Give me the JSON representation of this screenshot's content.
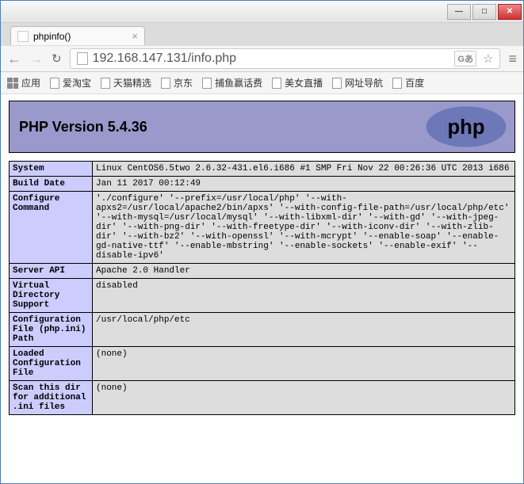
{
  "window": {
    "min": "—",
    "max": "□",
    "close": "✕"
  },
  "tab": {
    "title": "phpinfo()",
    "close": "×"
  },
  "toolbar": {
    "back": "←",
    "forward": "→",
    "reload": "↻",
    "url": "192.168.147.131/info.php",
    "translate": "Gあ",
    "star": "☆",
    "menu": "≡"
  },
  "bookmarks": {
    "apps": "应用",
    "items": [
      "爱淘宝",
      "天猫精选",
      "京东",
      "捕鱼赢话费",
      "美女直播",
      "网址导航",
      "百度"
    ]
  },
  "php": {
    "heading": "PHP Version 5.4.36",
    "logo_text": "php",
    "rows": [
      {
        "label": "System",
        "value": "Linux CentOS6.5two 2.6.32-431.el6.i686 #1 SMP Fri Nov 22 00:26:36 UTC 2013 i686"
      },
      {
        "label": "Build Date",
        "value": "Jan 11 2017 00:12:49"
      },
      {
        "label": "Configure Command",
        "value": "'./configure' '--prefix=/usr/local/php' '--with-apxs2=/usr/local/apache2/bin/apxs' '--with-config-file-path=/usr/local/php/etc' '--with-mysql=/usr/local/mysql' '--with-libxml-dir' '--with-gd' '--with-jpeg-dir' '--with-png-dir' '--with-freetype-dir' '--with-iconv-dir' '--with-zlib-dir' '--with-bz2' '--with-openssl' '--with-mcrypt' '--enable-soap' '--enable-gd-native-ttf' '--enable-mbstring' '--enable-sockets' '--enable-exif' '--disable-ipv6'"
      },
      {
        "label": "Server API",
        "value": "Apache 2.0 Handler"
      },
      {
        "label": "Virtual Directory Support",
        "value": "disabled"
      },
      {
        "label": "Configuration File (php.ini) Path",
        "value": "/usr/local/php/etc"
      },
      {
        "label": "Loaded Configuration File",
        "value": "(none)"
      },
      {
        "label": "Scan this dir for additional .ini files",
        "value": "(none)"
      }
    ]
  }
}
